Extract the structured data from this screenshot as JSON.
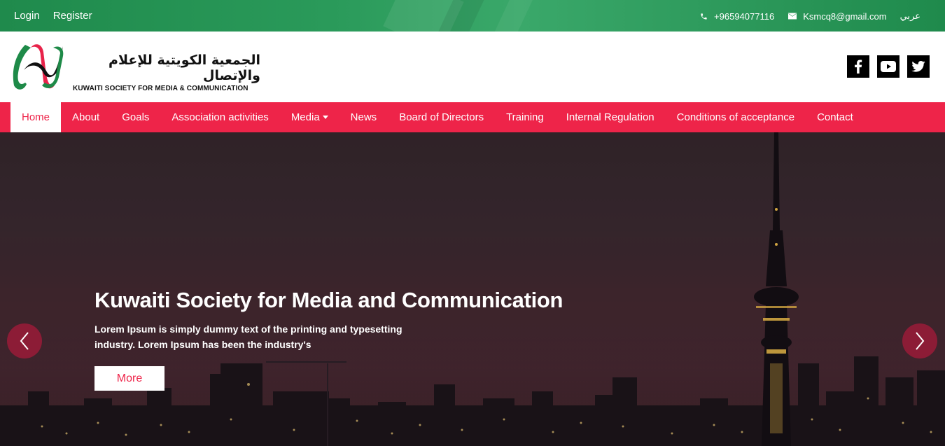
{
  "topbar": {
    "login": "Login",
    "register": "Register",
    "phone": "+96594077116",
    "email": "Ksmcq8@gmail.com",
    "language": "عربي",
    "phone_icon": "phone-icon",
    "email_icon": "envelope-icon",
    "background_color": "#2a9a5a"
  },
  "header": {
    "logo_text_ar": "الجمعية الكويتية للإعلام والإتصال",
    "logo_text_en": "KUWAITI SOCIETY FOR MEDIA & COMMUNICATION",
    "social": [
      "facebook-icon",
      "youtube-icon",
      "twitter-icon"
    ]
  },
  "nav": {
    "items": [
      {
        "label": "Home",
        "active": true
      },
      {
        "label": "About"
      },
      {
        "label": "Goals"
      },
      {
        "label": "Association activities"
      },
      {
        "label": "Media",
        "dropdown": true
      },
      {
        "label": "News"
      },
      {
        "label": "Board of Directors"
      },
      {
        "label": "Training"
      },
      {
        "label": "Internal Regulation"
      },
      {
        "label": "Conditions of acceptance"
      },
      {
        "label": "Contact"
      }
    ],
    "background_color": "#ee2449"
  },
  "hero": {
    "title": "Kuwaiti Society for Media and Communication",
    "text": "Lorem Ipsum is simply dummy text of the printing and typesetting industry. Lorem Ipsum has been the industry's",
    "button": "More",
    "prev_icon": "chevron-left-icon",
    "next_icon": "chevron-right-icon"
  }
}
